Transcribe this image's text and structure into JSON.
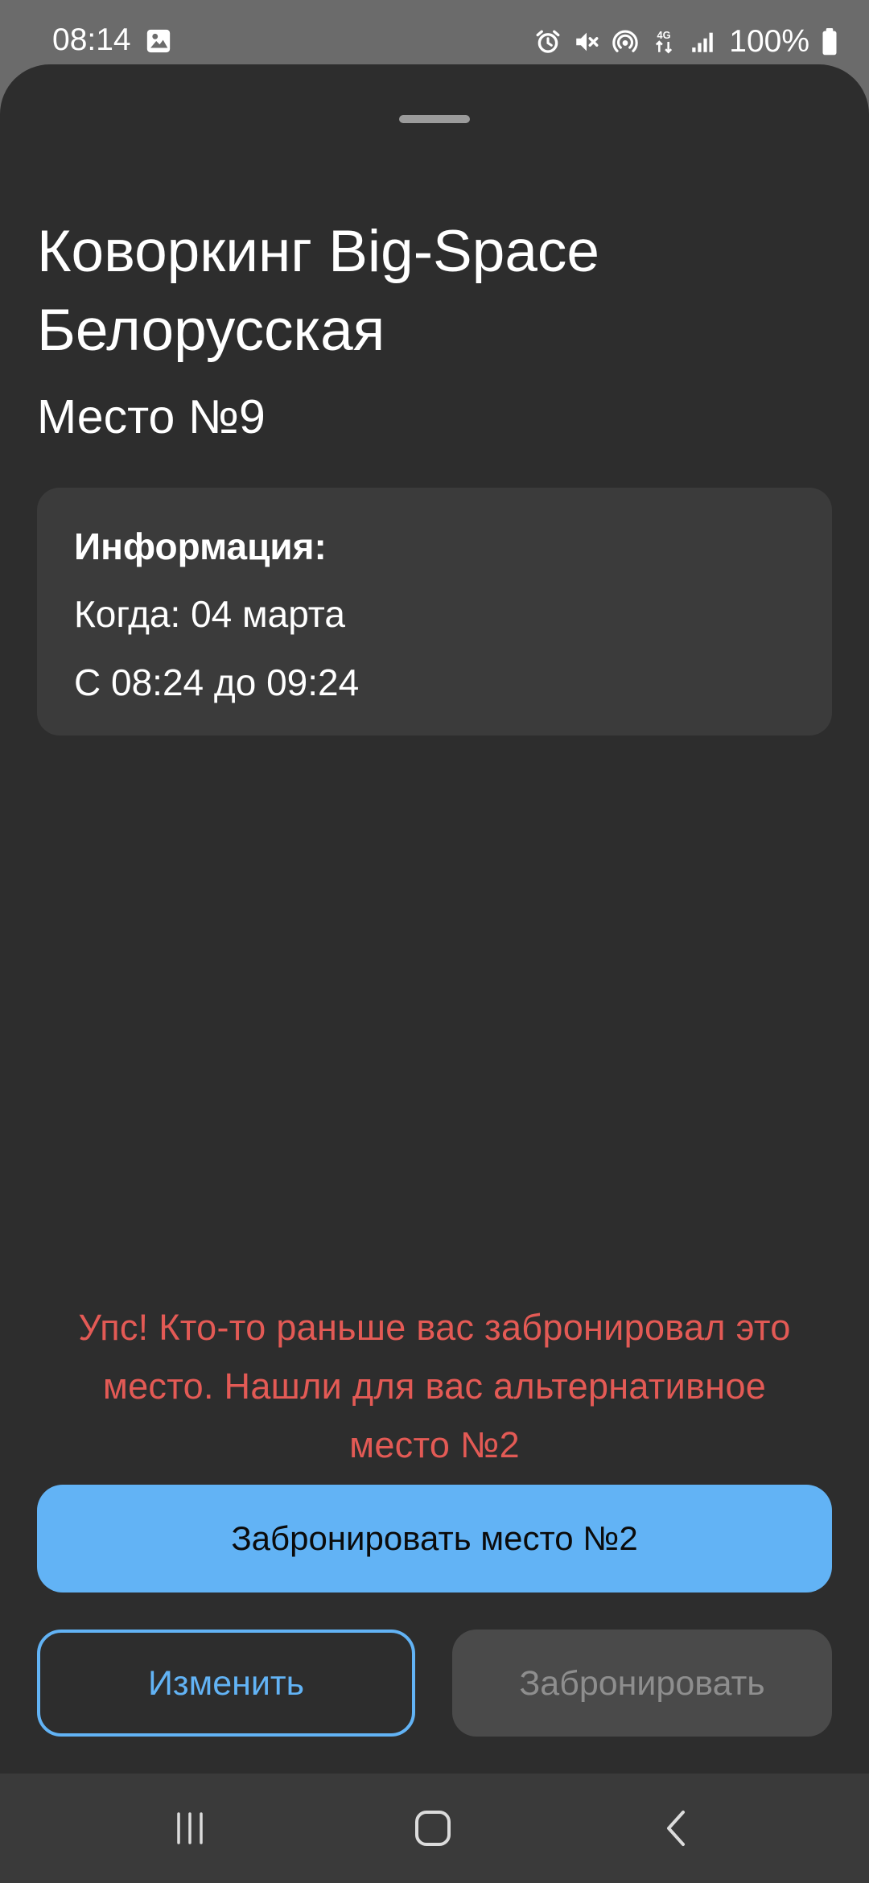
{
  "status_bar": {
    "time": "08:14",
    "battery": "100%",
    "icons": [
      "gallery-icon",
      "alarm-icon",
      "mute-icon",
      "hotspot-icon",
      "network-4g-icon",
      "signal-icon",
      "battery-icon"
    ]
  },
  "header": {
    "title": "Коворкинг Big-Space Белорусская",
    "subtitle": "Место №9"
  },
  "info": {
    "title": "Информация:",
    "when": "Когда: 04 марта",
    "time_range": "С 08:24 до 09:24"
  },
  "warning": {
    "text": "Упс! Кто-то раньше вас забронировал это место. Нашли для вас альтернативное место №2"
  },
  "actions": {
    "primary_label": "Забронировать место №2",
    "edit_label": "Изменить",
    "book_label": "Забронировать"
  },
  "nav": {
    "icons": [
      "recent-apps-icon",
      "home-icon",
      "back-icon"
    ]
  },
  "colors": {
    "background": "#2d2d2d",
    "card": "#3b3b3b",
    "accent": "#62b3f5",
    "warning": "#e35a55",
    "disabled_text": "#8e8e8e"
  }
}
